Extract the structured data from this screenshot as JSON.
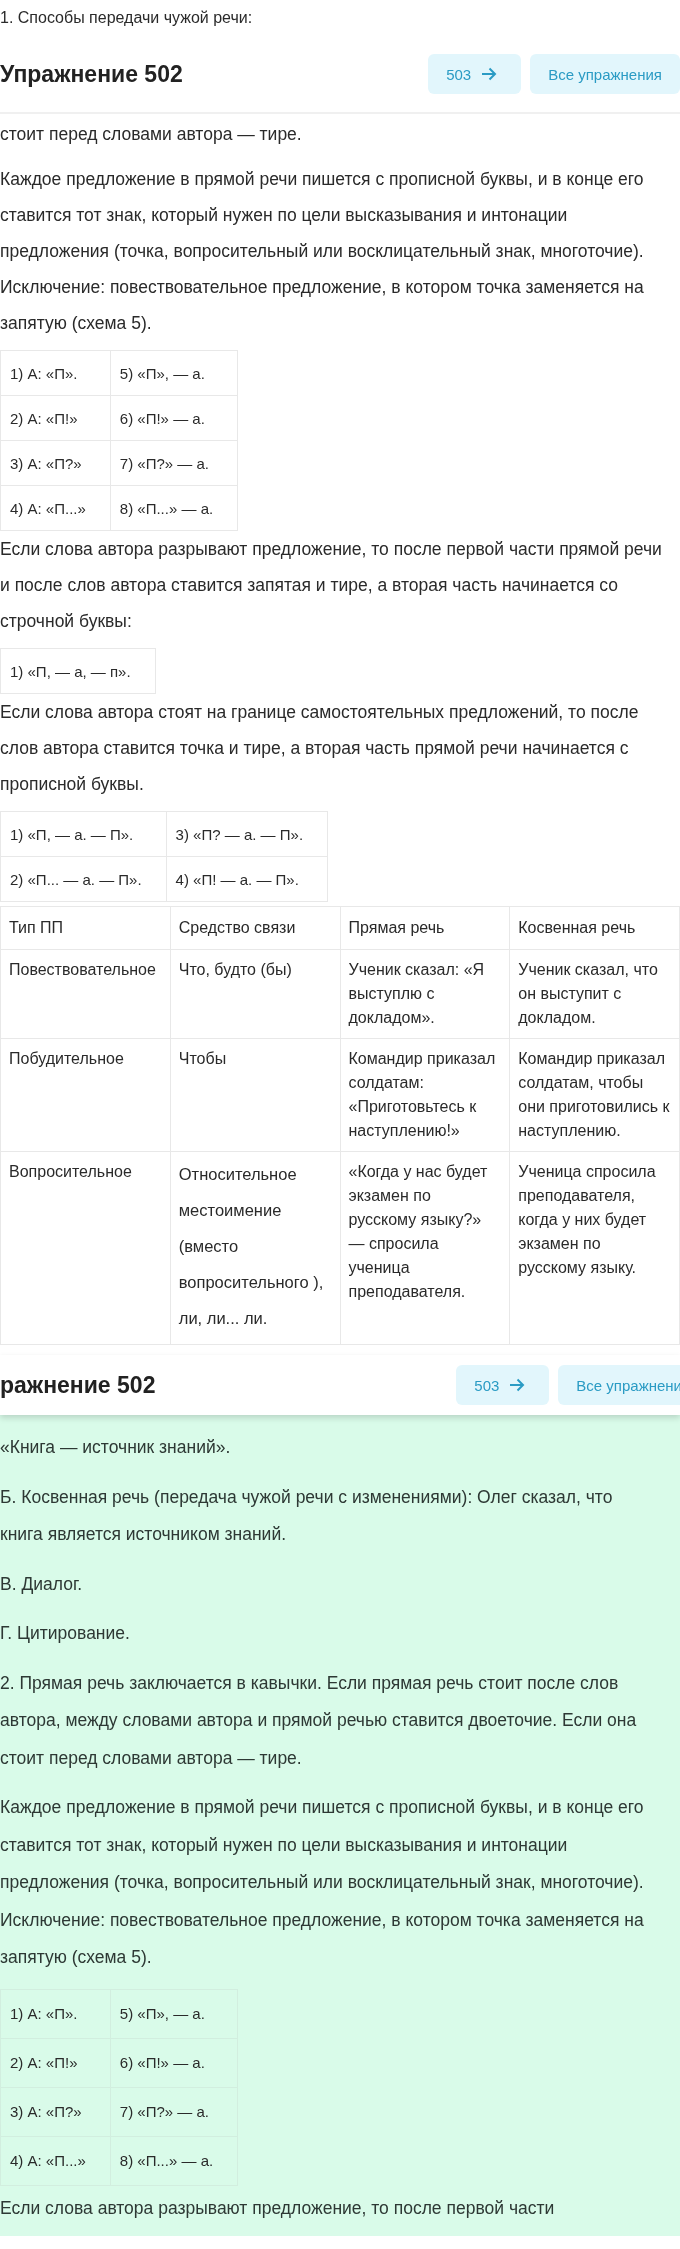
{
  "intro_line": "1. Способы передачи чужой речи:",
  "sections": [
    {
      "highlighted": false,
      "header": {
        "title": "Упражнение 502",
        "next_button": "503",
        "all_button": "Все упражнения",
        "elevated": false
      },
      "blocks": [
        {
          "kind": "paragraph",
          "text": "стоит перед словами автора — тире."
        },
        {
          "kind": "paragraph",
          "text": "Каждое предложение в прямой речи пишется с прописной буквы, и в конце его ставится тот знак, который нужен по цели высказывания и интонации предложения (точка, вопросительный или восклицательный знак, многоточие). Исключение: повествовательное предложение, в котором точка заменяется на запятую (схема 5)."
        },
        {
          "kind": "grid",
          "rows": [
            [
              "1) А: «П».",
              "5) «П», — а."
            ],
            [
              "2) А: «П!»",
              "6) «П!» — а."
            ],
            [
              "3) А: «П?»",
              "7) «П?» — а."
            ],
            [
              "4) А: «П...»",
              "8) «П...» — а."
            ]
          ]
        },
        {
          "kind": "paragraph",
          "text": "Если слова автора разрывают предложение, то после первой части прямой речи и после слов автора ставится запятая и тире, а вторая часть начинается со строчной буквы:"
        },
        {
          "kind": "grid",
          "rows": [
            [
              "1) «П, — а, — п»."
            ]
          ]
        },
        {
          "kind": "paragraph",
          "text": "Если слова автора стоят на границе самостоятельных предложений, то после слов автора ставится точка и тире, а вторая часть прямой речи начинается с прописной буквы."
        },
        {
          "kind": "grid",
          "rows": [
            [
              "1) «П, — а. — П».",
              "3) «П? — а. — П»."
            ],
            [
              "2) «П... — а. — П».",
              "4) «П! — а. — П»."
            ]
          ]
        },
        {
          "kind": "table",
          "columns": [
            "Тип ПП",
            "Средство связи",
            "Прямая речь",
            "Косвенная речь"
          ],
          "rows": [
            [
              {
                "text": "Повествовательное",
                "kind": "compact"
              },
              {
                "text": "Что, будто (бы)",
                "kind": "compact"
              },
              {
                "text": "Ученик сказал: «Я выступлю с докладом».",
                "kind": "compact"
              },
              {
                "text": "Ученик сказал, что он выступит с докладом.",
                "kind": "compact"
              }
            ],
            [
              {
                "text": "Побудительное",
                "kind": "compact"
              },
              {
                "text": "Чтобы",
                "kind": "compact"
              },
              {
                "text": "Командир приказал солдатам: «Приготовьтесь к наступлению!»",
                "kind": "compact"
              },
              {
                "text": "Командир приказал солдатам, чтобы они приготовились к наступлению.",
                "kind": "compact"
              }
            ],
            [
              {
                "text": "Вопросительное",
                "kind": "compact"
              },
              {
                "text": "Относительное местоимение (вместо вопросительного ), ли, ли... ли.",
                "kind": "spaced"
              },
              {
                "text": "«Когда у нас будет экзамен по русскому языку?» — спросила ученица преподавателя.",
                "kind": "compact"
              },
              {
                "text": "Ученица спросила преподавателя, когда у них будет экзамен по русскому языку.",
                "kind": "compact"
              }
            ]
          ]
        }
      ]
    },
    {
      "highlighted": true,
      "header": {
        "title": "ражнение 502",
        "next_button": "503",
        "all_button": "Все упражнени",
        "elevated": true
      },
      "blocks": [
        {
          "kind": "paragraph",
          "text": "«Книга — источник знаний»."
        },
        {
          "kind": "paragraph",
          "text": "Б. Косвенная речь (передача чужой речи с изменениями): Олег сказал, что книга является источником знаний."
        },
        {
          "kind": "paragraph",
          "text": "В. Диалог."
        },
        {
          "kind": "paragraph",
          "text": "Г. Цитирование."
        },
        {
          "kind": "paragraph",
          "text": "2. Прямая речь заключается в кавычки. Если прямая речь стоит после слов автора, между словами автора и прямой речью ставится двоеточие. Если она стоит перед словами автора — тире."
        },
        {
          "kind": "paragraph",
          "text": "Каждое предложение в прямой речи пишется с прописной буквы, и в конце его ставится тот знак, который нужен по цели высказывания и интонации предложения (точка, вопросительный или восклицательный знак, многоточие). Исключение: повествовательное предложение, в котором точка заменяется на запятую (схема 5)."
        },
        {
          "kind": "grid",
          "rows": [
            [
              "1) А: «П».",
              "5) «П», — а."
            ],
            [
              "2) А: «П!»",
              "6) «П!» — а."
            ],
            [
              "3) А: «П?»",
              "7) «П?» — а."
            ],
            [
              "4) А: «П...»",
              "8) «П...» — а."
            ]
          ]
        },
        {
          "kind": "paragraph",
          "text": "Если слова автора разрывают предложение, то после первой части"
        }
      ]
    }
  ]
}
